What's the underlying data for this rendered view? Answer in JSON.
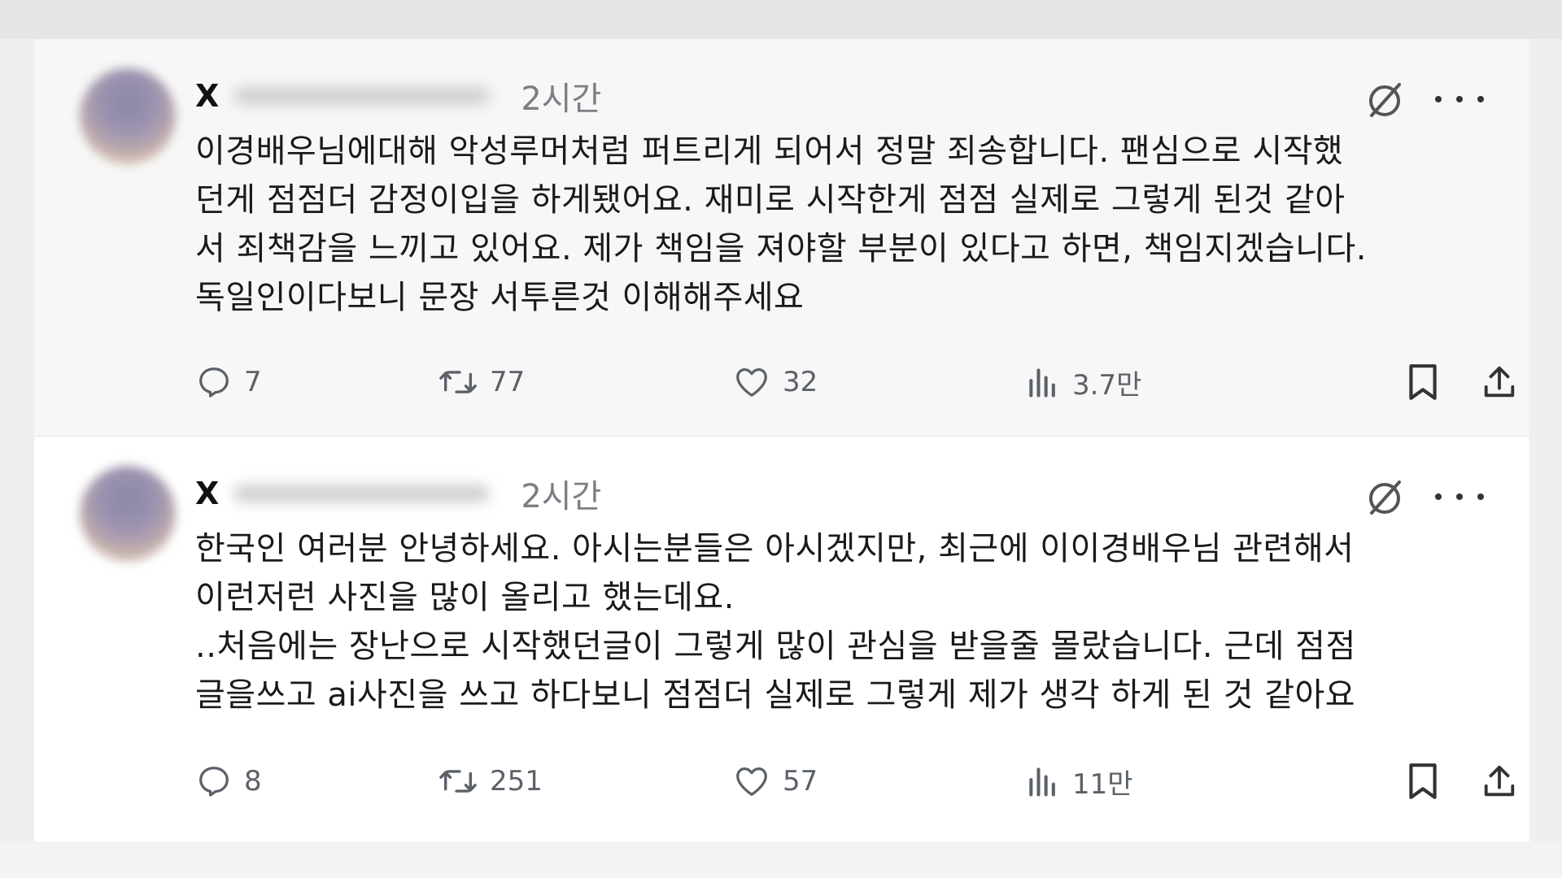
{
  "tweets": [
    {
      "author_name": "X",
      "time": "2시간",
      "lines": [
        "이경배우님에대해 악성루머처럼 퍼트리게 되어서 정말 죄송합니다. 팬심으로 시작했",
        "던게 점점더 감정이입을 하게됐어요. 재미로 시작한게 점점 실제로 그렇게 된것 같아",
        "서 죄책감을 느끼고 있어요. 제가 책임을 져야할 부분이 있다고 하면, 책임지겠습니다.",
        "독일인이다보니 문장 서투른것 이해해주세요"
      ],
      "replies": "7",
      "retweets": "77",
      "likes": "32",
      "views": "3.7만"
    },
    {
      "author_name": "X",
      "time": "2시간",
      "lines": [
        "한국인 여러분 안녕하세요. 아시는분들은 아시겠지만, 최근에 이이경배우님 관련해서",
        "이런저런 사진을 많이 올리고 했는데요.",
        "..처음에는 장난으로 시작했던글이 그렇게 많이 관심을 받을줄 몰랐습니다. 근데 점점",
        "글을쓰고 ai사진을 쓰고 하다보니 점점더 실제로 그렇게 제가 생각 하게 된 것 같아요"
      ],
      "replies": "8",
      "retweets": "251",
      "likes": "57",
      "views": "11만"
    }
  ],
  "icons": {
    "reply": "reply-icon",
    "retweet": "retweet-icon",
    "like": "heart-icon",
    "views": "views-icon",
    "bookmark": "bookmark-icon",
    "share": "share-icon",
    "grok": "grok-icon",
    "more": "more-icon"
  },
  "colors": {
    "icon_gray": "#5b6168",
    "text": "#1a1a1a",
    "time_gray": "#7a7f84"
  }
}
